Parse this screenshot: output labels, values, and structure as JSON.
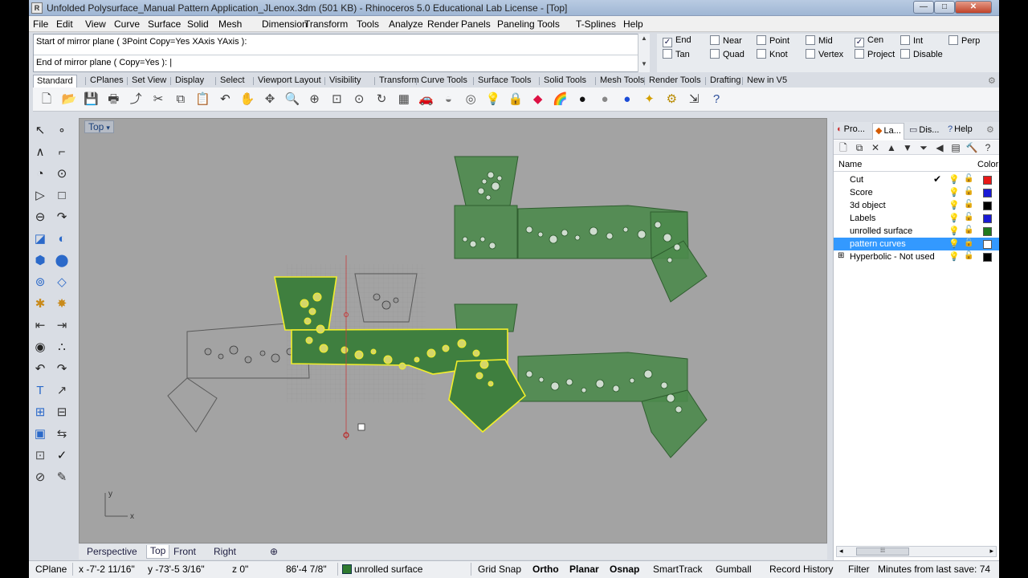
{
  "window": {
    "title": "Unfolded Polysurface_Manual Pattern Application_JLenox.3dm (501 KB) - Rhinoceros 5.0 Educational Lab License - [Top]",
    "min_glyph": "—",
    "max_glyph": "□",
    "close_glyph": "✕"
  },
  "menu": [
    "File",
    "Edit",
    "View",
    "Curve",
    "Surface",
    "Solid",
    "Mesh",
    "Dimension",
    "Transform",
    "Tools",
    "Analyze",
    "Render",
    "Panels",
    "Paneling Tools",
    "T-Splines",
    "Help"
  ],
  "command": {
    "history": "Start of mirror plane ( 3Point  Copy=Yes  XAxis  YAxis ):",
    "prompt": "End of mirror plane ( Copy=Yes ):",
    "scroll_up": "▲",
    "scroll_down": "▼"
  },
  "osnaps": [
    {
      "label": "End",
      "checked": true
    },
    {
      "label": "Near",
      "checked": false
    },
    {
      "label": "Point",
      "checked": false
    },
    {
      "label": "Mid",
      "checked": false
    },
    {
      "label": "Cen",
      "checked": true
    },
    {
      "label": "Int",
      "checked": false
    },
    {
      "label": "Perp",
      "checked": false
    },
    {
      "label": "Tan",
      "checked": false
    },
    {
      "label": "Quad",
      "checked": false
    },
    {
      "label": "Knot",
      "checked": false
    },
    {
      "label": "Vertex",
      "checked": false
    },
    {
      "label": "Project",
      "checked": false
    },
    {
      "label": "Disable",
      "checked": false
    }
  ],
  "toolbar_tabs": [
    "Standard",
    "CPlanes",
    "Set View",
    "Display",
    "Select",
    "Viewport Layout",
    "Visibility",
    "Transform",
    "Curve Tools",
    "Surface Tools",
    "Solid Tools",
    "Mesh Tools",
    "Render Tools",
    "Drafting",
    "New in V5"
  ],
  "toolbar_icons": [
    "new-icon",
    "open-icon",
    "save-icon",
    "print-icon",
    "import-icon",
    "cut-icon",
    "copy-icon",
    "paste-icon",
    "undo-icon",
    "pan-hand-icon",
    "move-view-icon",
    "zoom-icon",
    "zoom-window-icon",
    "zoom-extents-icon",
    "zoom-selected-icon",
    "rotate-view-icon",
    "four-viewports-icon",
    "car-icon",
    "render-preview-icon",
    "cplane-icon",
    "lightbulb-icon",
    "lock-icon",
    "material-icon",
    "color-wheel-icon",
    "sphere-shaded-icon",
    "sphere-gray-icon",
    "sphere-blue-icon",
    "light-icon",
    "gears-icon",
    "snap-icon",
    "help-icon"
  ],
  "toolbar_glyphs": [
    "🗋",
    "📂",
    "💾",
    "🖶",
    "⤴",
    "✂",
    "⧉",
    "📋",
    "↶",
    "✋",
    "✥",
    "🔍",
    "⊕",
    "⊡",
    "⊙",
    "↻",
    "▦",
    "🚗",
    "◒",
    "◎",
    "💡",
    "🔒",
    "◆",
    "🌈",
    "●",
    "●",
    "●",
    "✦",
    "⚙",
    "⇲",
    "?"
  ],
  "left_tools": [
    "↖",
    "∘",
    "∧",
    "⌐",
    "◔",
    "⊙",
    "▷",
    "□",
    "⊖",
    "↷",
    "◪",
    "◐",
    "⬢",
    "⬤",
    "⊚",
    "◇",
    "✱",
    "✸",
    "⇤",
    "⇥",
    "◉",
    "∴",
    "↶",
    "↷",
    "T",
    "↗",
    "⊞",
    "⊟",
    "▣",
    "⇆",
    "⊡",
    "✓",
    "⊘",
    "✎"
  ],
  "viewport": {
    "name": "Top",
    "dropdown": "▾",
    "axis_y": "y",
    "axis_x": "x"
  },
  "viewport_tabs": [
    "Perspective",
    "Top",
    "Front",
    "Right",
    "⊕"
  ],
  "active_viewport_tab": "Top",
  "panel": {
    "tabs": [
      "Pro...",
      "La...",
      "Dis...",
      "Help"
    ],
    "active_tab": "La...",
    "tools": [
      "🗋",
      "⧉",
      "✕",
      "▲",
      "▼",
      "⏷",
      "◀",
      "▤",
      "🔨",
      "?"
    ],
    "col_name": "Name",
    "col_color": "Color",
    "layers": [
      {
        "name": "Cut",
        "color": "#e81818",
        "current": true,
        "selected": false,
        "bulb_color": "#d4b800"
      },
      {
        "name": "Score",
        "color": "#1a1ad6",
        "current": false,
        "selected": false,
        "bulb_color": "#d4b800"
      },
      {
        "name": "3d object",
        "color": "#000000",
        "current": false,
        "selected": false,
        "bulb_color": "#2a62c2"
      },
      {
        "name": "Labels",
        "color": "#1a1ad6",
        "current": false,
        "selected": false,
        "bulb_color": "#2a62c2"
      },
      {
        "name": "unrolled surface",
        "color": "#1f7a1f",
        "current": false,
        "selected": false,
        "bulb_color": "#d4b800"
      },
      {
        "name": "pattern curves",
        "color": "#ffffff",
        "current": false,
        "selected": true,
        "bulb_color": "#ffffff"
      },
      {
        "name": "Hyperbolic - Not used",
        "color": "#000000",
        "current": false,
        "selected": false,
        "bulb_color": "#d4b800",
        "expander": "⊞"
      }
    ],
    "check_glyph": "✔",
    "lock_glyph": "🔓",
    "bulb_glyph": "💡",
    "scroll_left": "◂",
    "scroll_right": "▸"
  },
  "status": {
    "cplane": "CPlane",
    "x": "x -7'-2 11/16\"",
    "y": "y -73'-5 3/16\"",
    "z": "z 0\"",
    "distance": "86'-4 7/8\"",
    "layer": "unrolled surface",
    "layer_color": "#2f7a2f",
    "grid_snap": "Grid Snap",
    "ortho": "Ortho",
    "planar": "Planar",
    "osnap": "Osnap",
    "smarttrack": "SmartTrack",
    "gumball": "Gumball",
    "record_history": "Record History",
    "filter": "Filter",
    "save_info": "Minutes from last save: 74"
  }
}
